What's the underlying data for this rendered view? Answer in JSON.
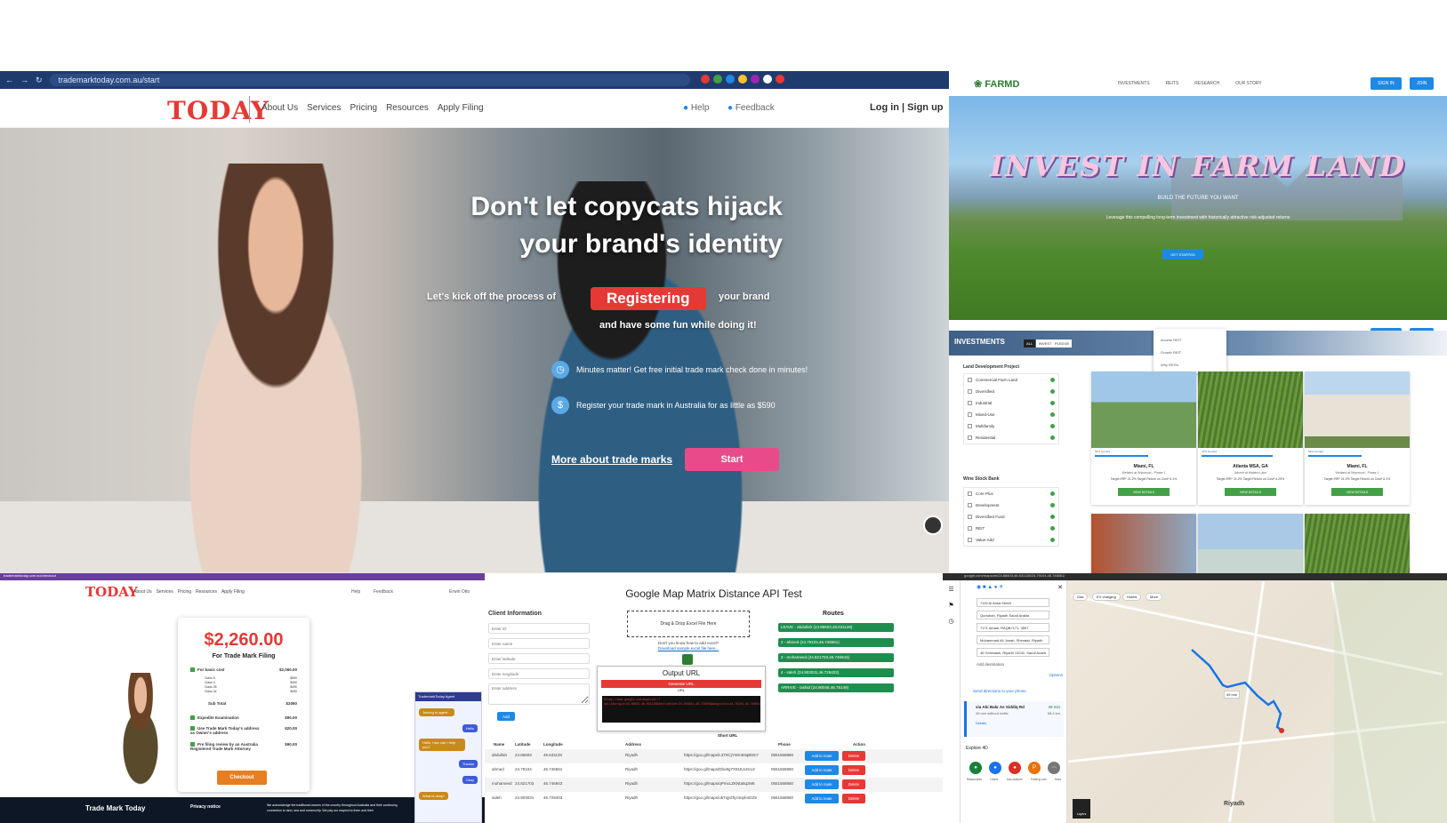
{
  "p1": {
    "url": "trademarktoday.com.au/start",
    "logo": "TODAY",
    "nav": [
      "About Us",
      "Services",
      "Pricing",
      "Resources",
      "Apply Filing"
    ],
    "help": "Help",
    "feedback": "Feedback",
    "login": "Log in | Sign up",
    "headline1": "Don't let copycats hijack",
    "headline2": "your brand's identity",
    "kick": "Let's kick off the process of",
    "registering": "Registering",
    "your_brand": "your brand",
    "fun": "and have some fun while doing it!",
    "feat1": "Minutes matter! Get free initial trade mark check done in minutes!",
    "feat2": "Register your trade mark in Australia for as little as $590",
    "more": "More about trade marks",
    "start": "Start"
  },
  "p2": {
    "logo": "FARMD",
    "nav": [
      "INVESTMENTS",
      "REITS",
      "RESEARCH",
      "OUR STORY"
    ],
    "signin": "SIGN IN",
    "join": "JOIN",
    "headline": "INVEST IN FARM LAND",
    "build": "BUILD THE FUTURE YOU WANT",
    "leverage": "Leverage this compelling long-term investment with historically attractive risk-adjusted returns",
    "get_started": "GET STARTED",
    "investments": "INVESTMENTS",
    "pills": [
      "ALL",
      "INVEST",
      "PLEDGE"
    ],
    "dropdown": [
      "Income REIT",
      "Growth REIT",
      "Why REITs"
    ],
    "filter1_title": "Land Development Project",
    "filter1": [
      "Commercial Farm Land",
      "Diversified",
      "Industrial",
      "Mixed-Use",
      "Multifamily",
      "Residential"
    ],
    "filter2_title": "Wine Stock Bank",
    "filter2": [
      "Core Plus",
      "Development",
      "Diversified Fund",
      "REIT",
      "Value-Add"
    ],
    "cards": [
      {
        "city": "Miami, FL",
        "desc": "Wetland at Wynwood - Phase 1",
        "funded": "56% Funded",
        "stats": "Target IRR* 21.2%  Target Return on Cost* 6.1%"
      },
      {
        "city": "Atlanta MSA, GA",
        "desc": "Advent at Walters Lake",
        "funded": "70% Funded",
        "stats": "Target IRR* 21.2%  Target Return on Cost* 6.25%"
      },
      {
        "city": "Miami, FL",
        "desc": "Wetland at Wynwood - Phase 1",
        "funded": "56% Funded",
        "stats": "Target IRR* 21.2%  Target Return on Cost* 6.1%"
      }
    ],
    "view_details": "VIEW DETAILS"
  },
  "p3": {
    "url": "trademarktoday.com.au/checkout",
    "logo": "TODAY",
    "nav": [
      "About Us",
      "Services",
      "Pricing",
      "Resources",
      "Apply Filing"
    ],
    "help": "Help",
    "feedback": "Feedback",
    "user": "Erwin Otto",
    "amount": "$2,260.00",
    "for": "For Trade Mark Filing",
    "basic": "For basic cost",
    "basic_val": "$2,060.00",
    "classes": [
      "Class 8",
      "Class 4",
      "Class 25",
      "Class 34"
    ],
    "class_vals": [
      "$590",
      "$490",
      "$490",
      "$490"
    ],
    "subtotal": "Sub Total",
    "subtotal_val": "$2060",
    "items": [
      {
        "label": "Expedite Examination",
        "val": "$90.00"
      },
      {
        "label": "Use Trade Mark Today's address as Owner's address",
        "val": "$20.00"
      },
      {
        "label": "Pre filing review by an Australia Registered Trade Mark Attorney",
        "val": "$90.00"
      }
    ],
    "checkout": "Checkout",
    "footer_title": "Trade Mark Today",
    "privacy": "Privacy notice",
    "ack": "We acknowledge the traditional owners of the country throughout Australia and their continuing connection to land, sea and community. We pay our respect to them and their",
    "chat_title": "TrademarkToday Agent",
    "chat": [
      "Joining to agent...",
      "Hello",
      "Hello, how can I help you?",
      "Thanks",
      "Okay",
      "What is okay?"
    ]
  },
  "p4": {
    "title": "Google Map Matrix Distance API Test",
    "client_info": "Client Information",
    "fields": [
      "Enter ID",
      "Enter name",
      "Enter latitude",
      "Enter longitude",
      "Enter address"
    ],
    "add": "Add",
    "drop": "Drag & Drop Excel File Here",
    "know": "Don't you know how to add excel?",
    "download": "Download sample excel file here...",
    "output": "Output URL",
    "generate": "Generate URL",
    "url_label": "URL",
    "code": "https://www.google.com/maps/dir/?api=1&origin=24.86603,46.631128&destination=24.903031,46.729403&waypoints=24.79104,46.746561|24.821703,46.746943&travelmode=driving",
    "routes": "Routes",
    "route_items": [
      "LEAVE - abdullah (24.86603,46.631128)",
      "2 - ahmed (24.79104,46.746561)",
      "3 - mohameed (24.821703,46.746943)",
      "4 - saleh (24.903031,46.729403)",
      "ARRIVE - rashid (24.90048,46.75149)"
    ],
    "delete": "Delete",
    "short_url": "Short URL",
    "headers": [
      "Name",
      "Latitude",
      "Longitude",
      "Address",
      "Phone",
      "Action"
    ],
    "rows": [
      {
        "name": "abdullah",
        "lat": "24.86603",
        "lng": "46.631128",
        "addr": "Riyadh",
        "url": "https://goo.gl/maps/L3T9CjYWm83qB9m7",
        "phone": "0551568880"
      },
      {
        "name": "ahmed",
        "lat": "24.79104",
        "lng": "46.746561",
        "addr": "Riyadh",
        "url": "https://goo.gl/maps/Dbo9g7X91tUxGrL8",
        "phone": "0551568880"
      },
      {
        "name": "mohameed",
        "lat": "24.821703",
        "lng": "46.746943",
        "addr": "Riyadh",
        "url": "https://goo.gl/maps/qPmxLZKNta5qzM6",
        "phone": "0551568880"
      },
      {
        "name": "saleh",
        "lat": "24.903031",
        "lng": "46.729403",
        "addr": "Riyadh",
        "url": "https://goo.gl/maps/ubTqjrZhjJ4nph4GZ9",
        "phone": "0551568880"
      }
    ],
    "add_route": "Add to route"
  },
  "p5": {
    "url": "google.com/maps/dir/24.86603,46.631128/24.79104,46.746561/",
    "stops": [
      "7115 Al Ahsa Street",
      "Qurtubah, Riyadh Saudi Arabia",
      "7171 Alhadi, RAQB7171, 3597",
      "Muhammad Ali Jonah, Shimaisi, Riyadh",
      "46 Ghirnatah, Riyadh 13242, Saudi Arabia"
    ],
    "add_dest": "Add destination",
    "options": "Options",
    "send": "Send directions to your phone",
    "via": "via Abi Bakr As Siddiq Rd",
    "time": "49 min",
    "dist": "58.4 km",
    "traffic": "49 min without traffic",
    "details": "Details",
    "explore": "Explore 4D",
    "explore_items": [
      "Restaurants",
      "Hotels",
      "Gas stations",
      "Parking Lots",
      "More"
    ],
    "chips": [
      "Gas",
      "EV charging",
      "Hotels",
      "More"
    ],
    "city": "Riyadh",
    "layers": "Layers",
    "route_time": "49 min"
  }
}
